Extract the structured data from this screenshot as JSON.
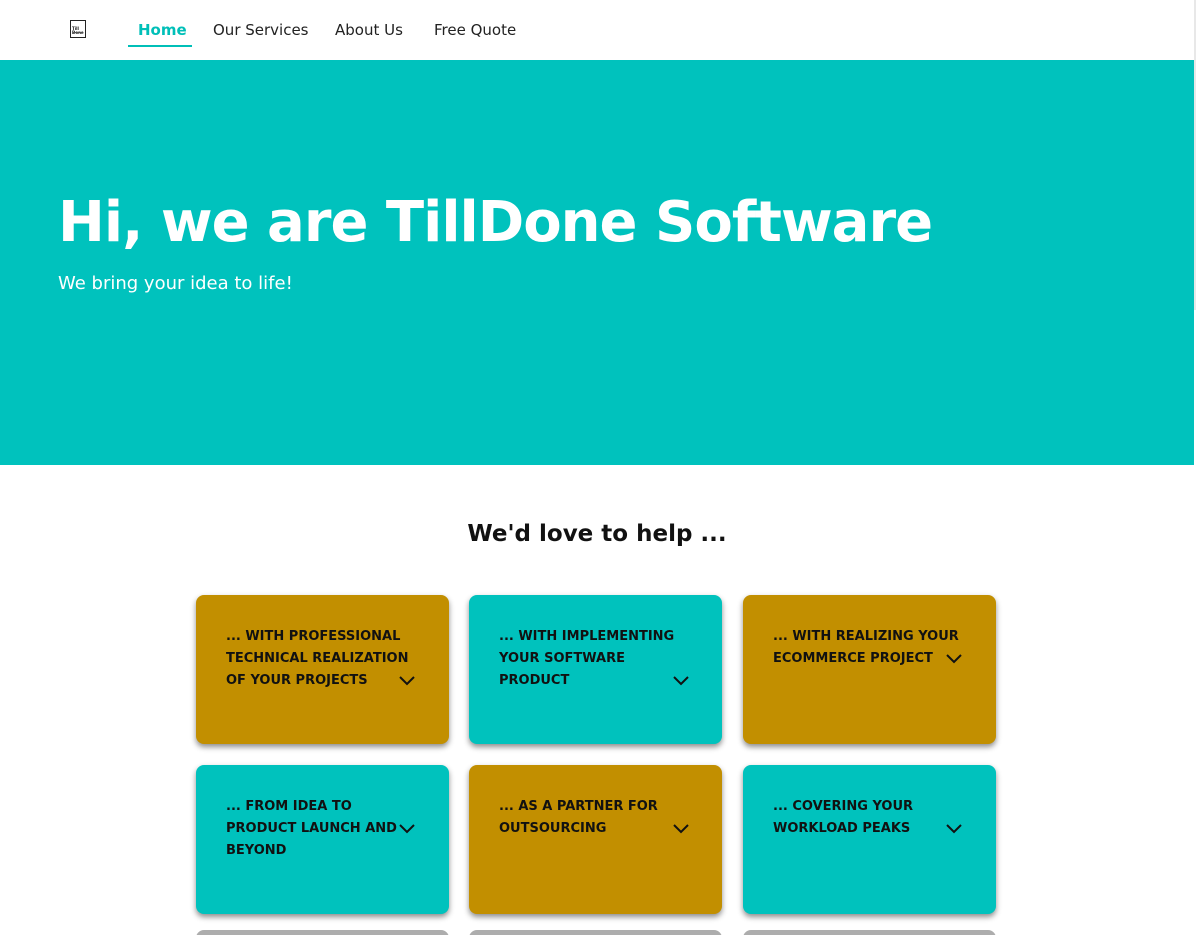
{
  "brand": {
    "logo_icon": "company-logo",
    "logo_text": "Till Done"
  },
  "nav": {
    "items": [
      {
        "label": "Home",
        "active": true
      },
      {
        "label": "Our Services",
        "active": false
      },
      {
        "label": "About Us",
        "active": false
      },
      {
        "label": "Free Quote",
        "active": false
      }
    ]
  },
  "hero": {
    "title": "Hi, we are TillDone Software",
    "subtitle": "We bring your idea to life!"
  },
  "help": {
    "title": "We'd love to help ...",
    "cards": [
      {
        "text": "... with professional technical realization of your projects",
        "color": "gold",
        "icon": "chevron-down-icon"
      },
      {
        "text": "... with implementing your software product",
        "color": "teal",
        "icon": "chevron-down-icon"
      },
      {
        "text": "... with realizing your eCommerce project",
        "color": "gold",
        "icon": "chevron-down-icon"
      },
      {
        "text": "... from idea to product launch and beyond",
        "color": "teal",
        "icon": "chevron-down-icon"
      },
      {
        "text": "... as a partner for outsourcing",
        "color": "gold",
        "icon": "chevron-down-icon"
      },
      {
        "text": "... covering your workload peaks",
        "color": "teal",
        "icon": "chevron-down-icon"
      }
    ]
  },
  "colors": {
    "accent": "#00bfb8",
    "hero_bg": "#00c2bd",
    "gold": "#c28f00"
  }
}
